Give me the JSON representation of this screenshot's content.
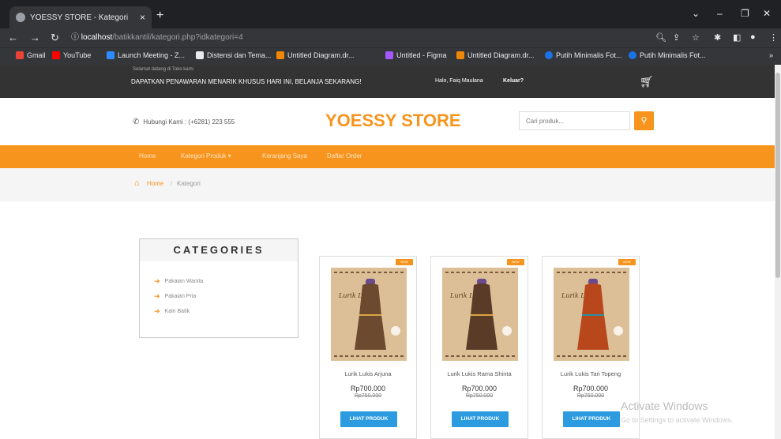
{
  "browser": {
    "tab_title": "YOESSY STORE - Kategori",
    "url_host": "localhost",
    "url_path": "/batikkantil/kategori.php?idkategori=4",
    "bookmarks": [
      "Gmail",
      "YouTube",
      "Launch Meeting - Z...",
      "Distensi dan Tema...",
      "Untitled Diagram.dr...",
      "Untitled - Figma",
      "Untitled Diagram.dr...",
      "Putih Minimalis Fot...",
      "Putih Minimalis Fot..."
    ]
  },
  "topbar": {
    "small_text": "Selamat datang di Toko kami",
    "promo": "DAPATKAN PENAWARAN MENARIK KHUSUS HARI INI, BELANJA SEKARANG!",
    "greeting": "Halo, Faiq Maulana",
    "logout": "Keluar?"
  },
  "header": {
    "phone": "Hubungi Kami : (+6281) 223 555",
    "brand": "YOESSY STORE",
    "search_placeholder": "Cari produk..."
  },
  "menu": [
    "Home",
    "Kategori Produk",
    "Keranjang Saya",
    "Daftar Order"
  ],
  "breadcrumb": {
    "home": "Home",
    "sep": "/",
    "current": "Kategori"
  },
  "categories": {
    "title": "CATEGORIES",
    "items": [
      "Pakaian Wanita",
      "Pakaian Pria",
      "Kain Batik"
    ]
  },
  "products": [
    {
      "name": "Lurik Lukis Arjuna",
      "price": "Rp700.000",
      "old_price": "Rp750.000",
      "button": "LIHAT PRODUK",
      "badge": "NEW",
      "image_label": "Lurik Lukis",
      "dress_color": "#6b4a2f"
    },
    {
      "name": "Lurik Lukis Rama Shinta",
      "price": "Rp700.000",
      "old_price": "Rp750.000",
      "button": "LIHAT PRODUK",
      "badge": "NEW",
      "image_label": "Lurik Lukis",
      "dress_color": "#5a3b28"
    },
    {
      "name": "Lurik Lukis Tari Topeng",
      "price": "Rp700.000",
      "old_price": "Rp750.000",
      "button": "LIHAT PRODUK",
      "badge": "NEW",
      "image_label": "Lurik Lukis",
      "dress_color": "#b8471c"
    }
  ],
  "watermark": {
    "line1": "Activate Windows",
    "line2": "Go to Settings to activate Windows."
  },
  "colors": {
    "accent": "#f7941d",
    "button": "#2d9be0",
    "topbar": "#333333"
  }
}
